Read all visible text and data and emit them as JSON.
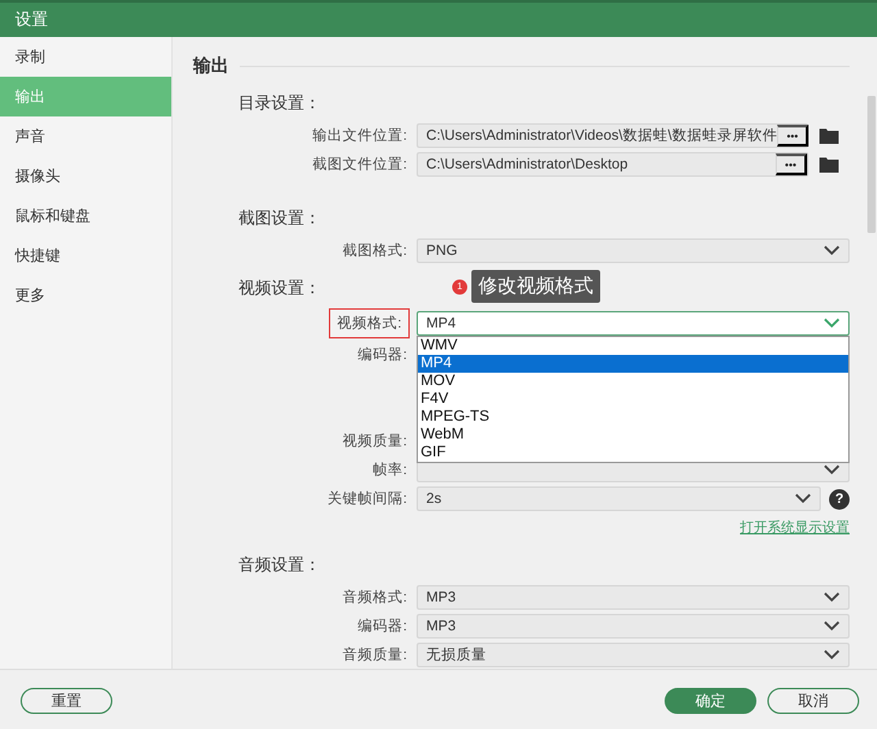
{
  "window": {
    "title": "设置"
  },
  "sidebar": {
    "items": [
      {
        "label": "录制",
        "selected": false
      },
      {
        "label": "输出",
        "selected": true
      },
      {
        "label": "声音",
        "selected": false
      },
      {
        "label": "摄像头",
        "selected": false
      },
      {
        "label": "鼠标和键盘",
        "selected": false
      },
      {
        "label": "快捷键",
        "selected": false
      },
      {
        "label": "更多",
        "selected": false
      }
    ]
  },
  "section_title": "输出",
  "directory": {
    "title": "目录设置：",
    "rows": [
      {
        "label": "输出文件位置:",
        "value": "C:\\Users\\Administrator\\Videos\\数据蛙\\数据蛙录屏软件",
        "button": "•••"
      },
      {
        "label": "截图文件位置:",
        "value": "C:\\Users\\Administrator\\Desktop",
        "button": "•••"
      }
    ]
  },
  "screenshot": {
    "title": "截图设置：",
    "rows": [
      {
        "label": "截图格式:",
        "value": "PNG"
      }
    ]
  },
  "video": {
    "title": "视频设置：",
    "annotation": {
      "number": "1",
      "text": "修改视频格式"
    },
    "format": {
      "label": "视频格式:",
      "value": "MP4",
      "highlighted": true,
      "options": [
        {
          "label": "WMV",
          "selected": false
        },
        {
          "label": "MP4",
          "selected": true
        },
        {
          "label": "MOV",
          "selected": false
        },
        {
          "label": "F4V",
          "selected": false
        },
        {
          "label": "MPEG-TS",
          "selected": false
        },
        {
          "label": "WebM",
          "selected": false
        },
        {
          "label": "GIF",
          "selected": false
        }
      ]
    },
    "encoder_label": "编码器:",
    "quality_label": "视频质量:",
    "framerate_label": "帧率:",
    "keyframe": {
      "label": "关键帧间隔:",
      "value": "2s",
      "help": "?"
    },
    "link": "打开系统显示设置"
  },
  "audio": {
    "title": "音频设置：",
    "rows": [
      {
        "label": "音频格式:",
        "value": "MP3"
      },
      {
        "label": "编码器:",
        "value": "MP3"
      },
      {
        "label": "音频质量:",
        "value": "无损质量"
      }
    ]
  },
  "footer": {
    "reset": "重置",
    "ok": "确定",
    "cancel": "取消"
  }
}
